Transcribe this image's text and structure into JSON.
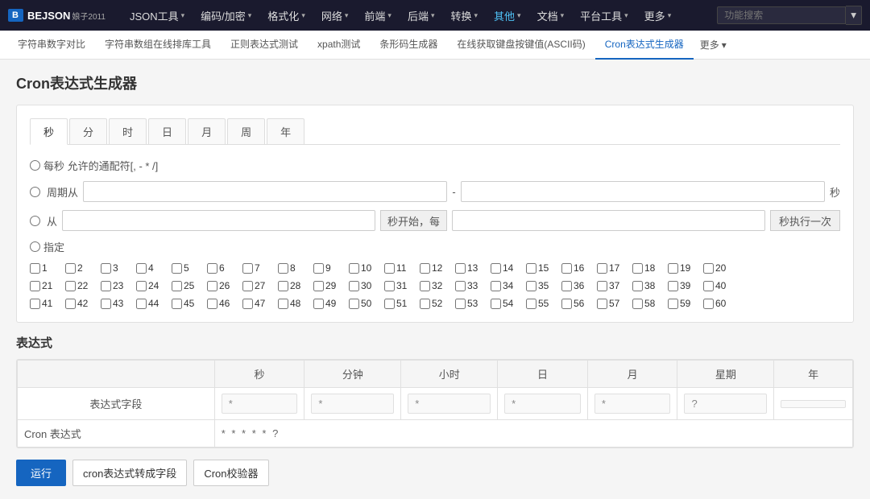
{
  "nav": {
    "logo": "B",
    "brand": "BEJSON",
    "brand_sub": "娘子2011",
    "items": [
      {
        "label": "JSON工具",
        "caret": true
      },
      {
        "label": "编码/加密",
        "caret": true
      },
      {
        "label": "格式化",
        "caret": true
      },
      {
        "label": "网络",
        "caret": true
      },
      {
        "label": "前端",
        "caret": true
      },
      {
        "label": "后端",
        "caret": true
      },
      {
        "label": "转换",
        "caret": true
      },
      {
        "label": "其他",
        "caret": true,
        "active": true
      },
      {
        "label": "文档",
        "caret": true
      },
      {
        "label": "平台工具",
        "caret": true
      },
      {
        "label": "更多",
        "caret": true
      }
    ],
    "search_placeholder": "功能搜索"
  },
  "subnav": {
    "items": [
      {
        "label": "字符串数字对比"
      },
      {
        "label": "字符串数组在线排库工具"
      },
      {
        "label": "正则表达式测试"
      },
      {
        "label": "xpath测试"
      },
      {
        "label": "条形码生成器"
      },
      {
        "label": "在线获取键盘按键值(ASCII码)"
      },
      {
        "label": "Cron表达式生成器",
        "active": true
      }
    ],
    "more": "更多"
  },
  "page": {
    "title": "Cron表达式生成器"
  },
  "tabs": [
    {
      "label": "秒",
      "active": true
    },
    {
      "label": "分"
    },
    {
      "label": "时"
    },
    {
      "label": "日"
    },
    {
      "label": "月"
    },
    {
      "label": "周"
    },
    {
      "label": "年"
    }
  ],
  "options": {
    "every_second": "每秒 允许的通配符[, - * /]",
    "period_label": "周期从",
    "period_sep": "-",
    "period_unit": "秒",
    "from_label": "从",
    "from_start": "秒开始，每",
    "from_end": "秒执行一次",
    "specify_label": "指定"
  },
  "checkboxes": {
    "numbers": [
      1,
      2,
      3,
      4,
      5,
      6,
      7,
      8,
      9,
      10,
      11,
      12,
      13,
      14,
      15,
      16,
      17,
      18,
      19,
      20,
      21,
      22,
      23,
      24,
      25,
      26,
      27,
      28,
      29,
      30,
      31,
      32,
      33,
      34,
      35,
      36,
      37,
      38,
      39,
      40,
      41,
      42,
      43,
      44,
      45,
      46,
      47,
      48,
      49,
      50,
      51,
      52,
      53,
      54,
      55,
      56,
      57,
      58,
      59,
      60
    ]
  },
  "expression": {
    "title": "表达式",
    "headers": [
      "秒",
      "分钟",
      "小时",
      "日",
      "月",
      "星期",
      "年"
    ],
    "fields": [
      "*",
      "*",
      "*",
      "*",
      "*",
      "?",
      ""
    ],
    "row_label": "表达式字段",
    "cron_label": "Cron 表达式",
    "cron_value": "* * * * * ?"
  },
  "buttons": {
    "run": "运行",
    "convert": "cron表达式转成字段",
    "validate": "Cron校验器"
  }
}
